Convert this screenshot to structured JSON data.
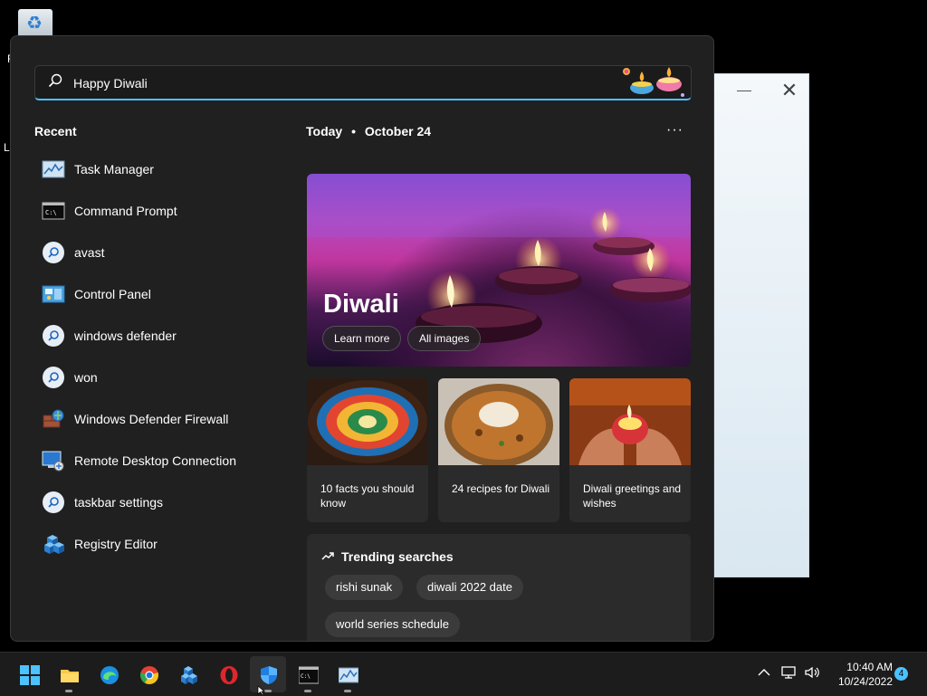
{
  "desktop": {
    "label_1": "R",
    "label_2": "Lo"
  },
  "search": {
    "value": "Happy Diwali"
  },
  "recent": {
    "title": "Recent",
    "items": [
      {
        "label": "Task Manager",
        "icon": "task-manager-icon"
      },
      {
        "label": "Command Prompt",
        "icon": "command-prompt-icon"
      },
      {
        "label": "avast",
        "icon": "search-icon"
      },
      {
        "label": "Control Panel",
        "icon": "control-panel-icon"
      },
      {
        "label": "windows defender",
        "icon": "search-icon"
      },
      {
        "label": "won",
        "icon": "search-icon"
      },
      {
        "label": "Windows Defender Firewall",
        "icon": "firewall-icon"
      },
      {
        "label": "Remote Desktop Connection",
        "icon": "remote-desktop-icon"
      },
      {
        "label": "taskbar settings",
        "icon": "search-icon"
      },
      {
        "label": "Registry Editor",
        "icon": "registry-editor-icon"
      }
    ]
  },
  "today": {
    "label": "Today",
    "separator": "•",
    "date": "October 24",
    "more": "···"
  },
  "hero": {
    "title": "Diwali",
    "learn_more": "Learn more",
    "all_images": "All images"
  },
  "cards": [
    {
      "caption": "10 facts you should know"
    },
    {
      "caption": "24 recipes for Diwali"
    },
    {
      "caption": "Diwali greetings and wishes"
    }
  ],
  "trending": {
    "title": "Trending searches",
    "chips": [
      "rishi sunak",
      "diwali 2022 date",
      "world series schedule"
    ]
  },
  "taskbar": {
    "apps": [
      "start-icon",
      "file-explorer-icon",
      "edge-icon",
      "chrome-icon",
      "registry-editor-icon",
      "opera-icon",
      "windows-security-icon",
      "command-prompt-icon",
      "task-manager-icon"
    ],
    "time": "10:40 AM",
    "date": "10/24/2022",
    "notifications": "4"
  },
  "colors": {
    "accent": "#4cc2ff",
    "flyout_bg": "#202020",
    "card_bg": "#2b2b2b"
  }
}
